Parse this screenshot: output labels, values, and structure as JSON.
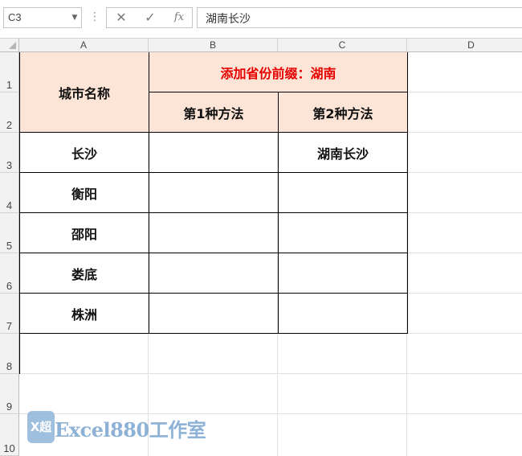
{
  "formula_bar": {
    "name_box": "C3",
    "dots": "⋮",
    "cancel_icon": "✕",
    "enter_icon": "✓",
    "fx_label": "fx",
    "formula": "湖南长沙"
  },
  "columns": [
    "A",
    "B",
    "C",
    "D"
  ],
  "rows": [
    "1",
    "2",
    "3",
    "4",
    "5",
    "6",
    "7",
    "8",
    "9",
    "10"
  ],
  "table": {
    "header_a": "城市名称",
    "header_bc": "添加省份前缀：湖南",
    "header_b": "第1种方法",
    "header_c": "第2种方法",
    "rows": [
      {
        "a": "长沙",
        "b": "",
        "c": "湖南长沙"
      },
      {
        "a": "衡阳",
        "b": "",
        "c": ""
      },
      {
        "a": "邵阳",
        "b": "",
        "c": ""
      },
      {
        "a": "娄底",
        "b": "",
        "c": ""
      },
      {
        "a": "株洲",
        "b": "",
        "c": ""
      }
    ]
  },
  "watermark": {
    "logo_text": "X超",
    "text": "Excel880工作室"
  },
  "colors": {
    "header_fill": "#fce4d6",
    "accent_red": "#e60000",
    "watermark": "#8db2d6"
  }
}
